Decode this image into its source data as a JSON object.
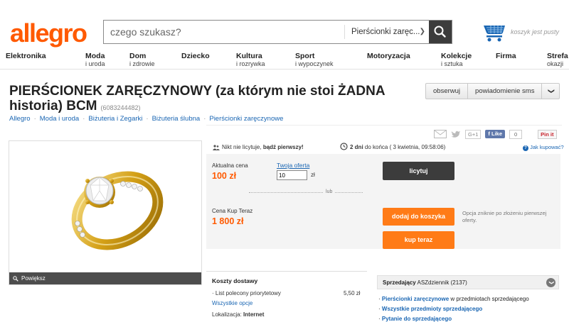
{
  "header": {
    "logo": "allegro",
    "search_placeholder": "czego szukasz?",
    "category_select": "Pierścionki zaręc...",
    "cart_text": "koszyk jest pusty"
  },
  "nav": [
    {
      "label": "Elektronika",
      "sub": ""
    },
    {
      "label": "Moda",
      "sub": "i uroda"
    },
    {
      "label": "Dom",
      "sub": "i zdrowie"
    },
    {
      "label": "Dziecko",
      "sub": ""
    },
    {
      "label": "Kultura",
      "sub": "i rozrywka"
    },
    {
      "label": "Sport",
      "sub": "i wypoczynek"
    },
    {
      "label": "Motoryzacja",
      "sub": ""
    },
    {
      "label": "Kolekcje",
      "sub": "i sztuka"
    },
    {
      "label": "Firma",
      "sub": ""
    },
    {
      "label": "Strefa",
      "sub": "okazji"
    }
  ],
  "product": {
    "title": "PIERŚCIONEK ZARĘCZYNOWY (za którym nie stoi ŻADNA historia) BCM",
    "id": "(6083244482)"
  },
  "actions": {
    "observe": "obserwuj",
    "notify": "powiadomienie sms"
  },
  "breadcrumbs": [
    "Allegro",
    "Moda i uroda",
    "Biżuteria i Zegarki",
    "Biżuteria ślubna",
    "Pierścionki zaręczynowe"
  ],
  "social": {
    "gplus": "G+1",
    "like": "Like",
    "like_count": "0",
    "pinit": "Pin it"
  },
  "gallery": {
    "zoom_label": "Powiększ"
  },
  "auction": {
    "bidders_text": "Nikt nie licytuje,",
    "bidders_bold": "bądź pierwszy!",
    "time_bold": "2 dni",
    "time_text": "do końca ( 3 kwietnia, 09:58:06)",
    "how_to_buy": "Jak kupować?",
    "current_price_label": "Aktualna cena",
    "current_price": "100 zł",
    "your_offer_label": "Twoja oferta",
    "your_offer_value": "10",
    "currency": "zł",
    "bid_button": "licytuj",
    "or": "lub",
    "buy_now_label": "Cena Kup Teraz",
    "buy_now_price": "1 800 zł",
    "add_to_cart": "dodaj do koszyka",
    "buy_now_button": "kup teraz",
    "option_note": "Opcja zniknie po złożeniu pierwszej oferty."
  },
  "shipping": {
    "title": "Koszty dostawy",
    "item_label": "List polecony priorytetowy",
    "item_price": "5,50 zł",
    "all_options": "Wszystkie opcje",
    "location_label": "Lokalizacja:",
    "location_value": "Internet"
  },
  "seller": {
    "label": "Sprzedający",
    "name": "ASZdziennik",
    "rating": "(2137)",
    "links": [
      {
        "bold": "Pierścionki zaręczynowe",
        "rest": " w przedmiotach sprzedającego"
      },
      {
        "bold": "Wszystkie przedmioty sprzedającego",
        "rest": ""
      },
      {
        "bold": "Pytanie do sprzedającego",
        "rest": ""
      }
    ]
  },
  "colors": {
    "brand": "#ff5a00",
    "link": "#1a66b3",
    "dark_button": "#3c3c3c"
  }
}
